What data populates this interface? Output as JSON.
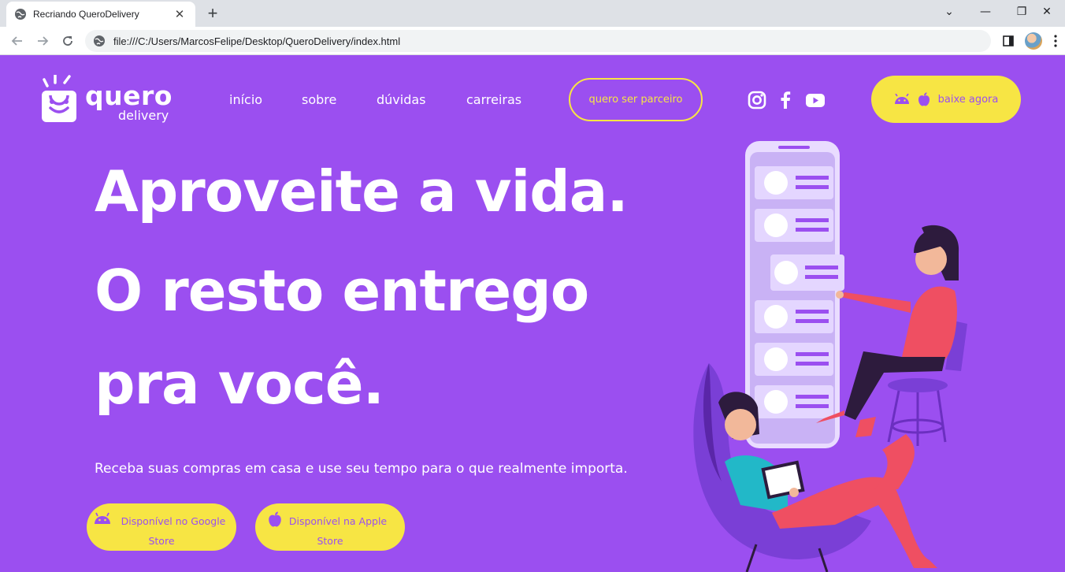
{
  "browser": {
    "tab_title": "Recriando QueroDelivery",
    "tab_close": "✕",
    "new_tab": "+",
    "url": "file:///C:/Users/MarcosFelipe/Desktop/QueroDelivery/index.html",
    "window_controls": [
      "⌄",
      "—",
      "❐",
      "✕"
    ]
  },
  "logo": {
    "word": "quero",
    "sub": "delivery"
  },
  "nav": {
    "links": [
      "início",
      "sobre",
      "dúvidas",
      "carreiras"
    ],
    "partner_button": "quero ser parceiro",
    "download_button": "baixe agora"
  },
  "social_icons": [
    "instagram-icon",
    "facebook-icon",
    "youtube-icon"
  ],
  "hero": {
    "lines": [
      "Aproveite a vida.",
      "O resto entrego",
      "pra você."
    ],
    "subtext": "Receba suas compras em casa e use seu tempo para o que realmente importa."
  },
  "stores": {
    "google": {
      "line1": "Disponível no Google",
      "line2": "Store"
    },
    "apple": {
      "line1": "Disponível na Apple",
      "line2": "Store"
    }
  },
  "colors": {
    "background": "#9b4ff0",
    "accent_yellow": "#f7e544",
    "text": "#ffffff"
  }
}
